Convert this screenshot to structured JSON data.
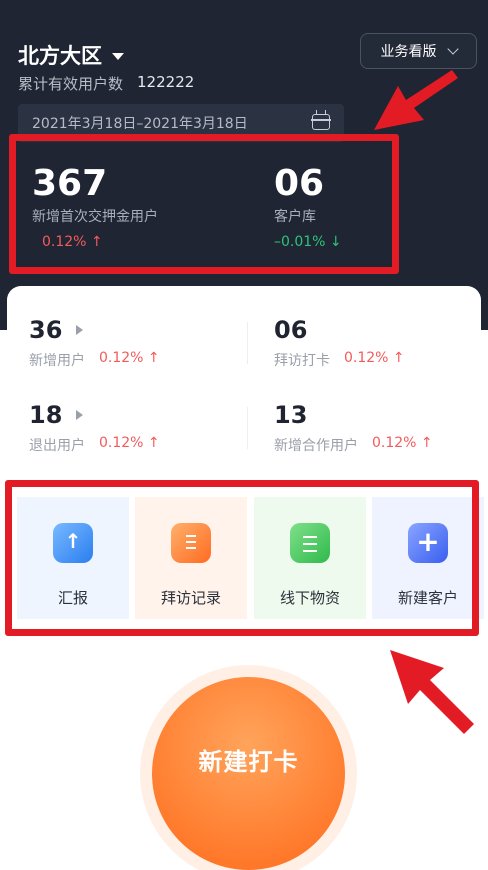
{
  "header": {
    "region": "北方大区",
    "cumulative_label": "累计有效用户数",
    "cumulative_value": "122222",
    "board_button": "业务看版",
    "date_range": "2021年3月18日–2021年3月18日"
  },
  "highlight_stats": [
    {
      "value": "367",
      "label": "新增首次交押金用户",
      "change": "0.12% ↑"
    },
    {
      "value": "06",
      "label": "客户库",
      "change": "–0.01% ↓"
    }
  ],
  "mini_stats": [
    {
      "value": "36",
      "label": "新增用户",
      "change": "0.12% ↑"
    },
    {
      "value": "06",
      "label": "拜访打卡",
      "change": "0.12% ↑"
    },
    {
      "value": "18",
      "label": "退出用户",
      "change": "0.12% ↑"
    },
    {
      "value": "13",
      "label": "新增合作用户",
      "change": "0.12% ↑"
    }
  ],
  "actions": [
    {
      "label": "汇报",
      "icon": "upload-icon",
      "bg": "#eef5ff"
    },
    {
      "label": "拜访记录",
      "icon": "document-icon",
      "bg": "#fff3ec"
    },
    {
      "label": "线下物资",
      "icon": "list-icon",
      "bg": "#effaef"
    },
    {
      "label": "新建客户",
      "icon": "add-icon",
      "bg": "#eff2ff"
    }
  ],
  "checkin_button": "新建打卡",
  "colors": {
    "header_bg": "#1f2533",
    "up": "#f25b5b",
    "down": "#2fc27a",
    "annotation": "#e31b25",
    "accent": "#ff6a1a"
  }
}
